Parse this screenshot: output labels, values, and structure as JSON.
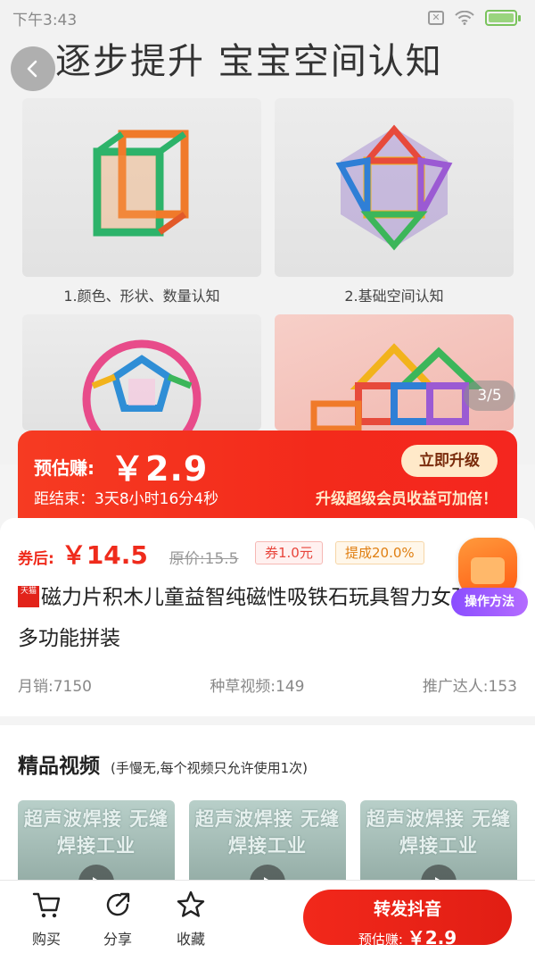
{
  "status_bar": {
    "time": "下午3:43",
    "sim_icon": "sim-x-icon",
    "wifi_icon": "wifi-icon",
    "battery_icon": "battery-charging-icon"
  },
  "hero": {
    "title": "逐步提升  宝宝空间认知",
    "cards": [
      {
        "caption": "1.颜色、形状、数量认知"
      },
      {
        "caption": "2.基础空间认知"
      },
      {
        "caption": ""
      },
      {
        "caption": ""
      }
    ],
    "page_indicator": "3/5"
  },
  "promo": {
    "estimate_label": "预估赚:",
    "estimate_value": "￥2.9",
    "countdown": "距结束：3天8小时16分4秒",
    "upgrade_button": "立即升级",
    "slogan": "升级超级会员收益可加倍！"
  },
  "product": {
    "coupon_price_label": "券后:",
    "coupon_price": "￥14.5",
    "original_price": "原价:15.5",
    "coupon_tag": "券1.0元",
    "commission_tag": "提成20.0%",
    "badge_text": "天猫",
    "title": "磁力片积木儿童益智纯磁性吸铁石玩具智力女孩动脑多功能拼装",
    "monthly_sales": "月销:7150",
    "seed_videos": "种草视频:149",
    "promoters": "推广达人:153",
    "howto_label": "操作方法"
  },
  "videos": {
    "title": "精品视频",
    "note": "(手慢无,每个视频只允许使用1次)",
    "items": [
      {
        "caption": "超声波焊接 无缝焊接工业"
      },
      {
        "caption": "超声波焊接 无缝焊接工业"
      },
      {
        "caption": "超声波焊接 无缝焊接工业"
      }
    ]
  },
  "bottom_bar": {
    "buy_label": "购买",
    "share_label": "分享",
    "favorite_label": "收藏",
    "cta_top": "转发抖音",
    "cta_bottom_label": "预估赚:",
    "cta_bottom_value": "￥2.9"
  }
}
